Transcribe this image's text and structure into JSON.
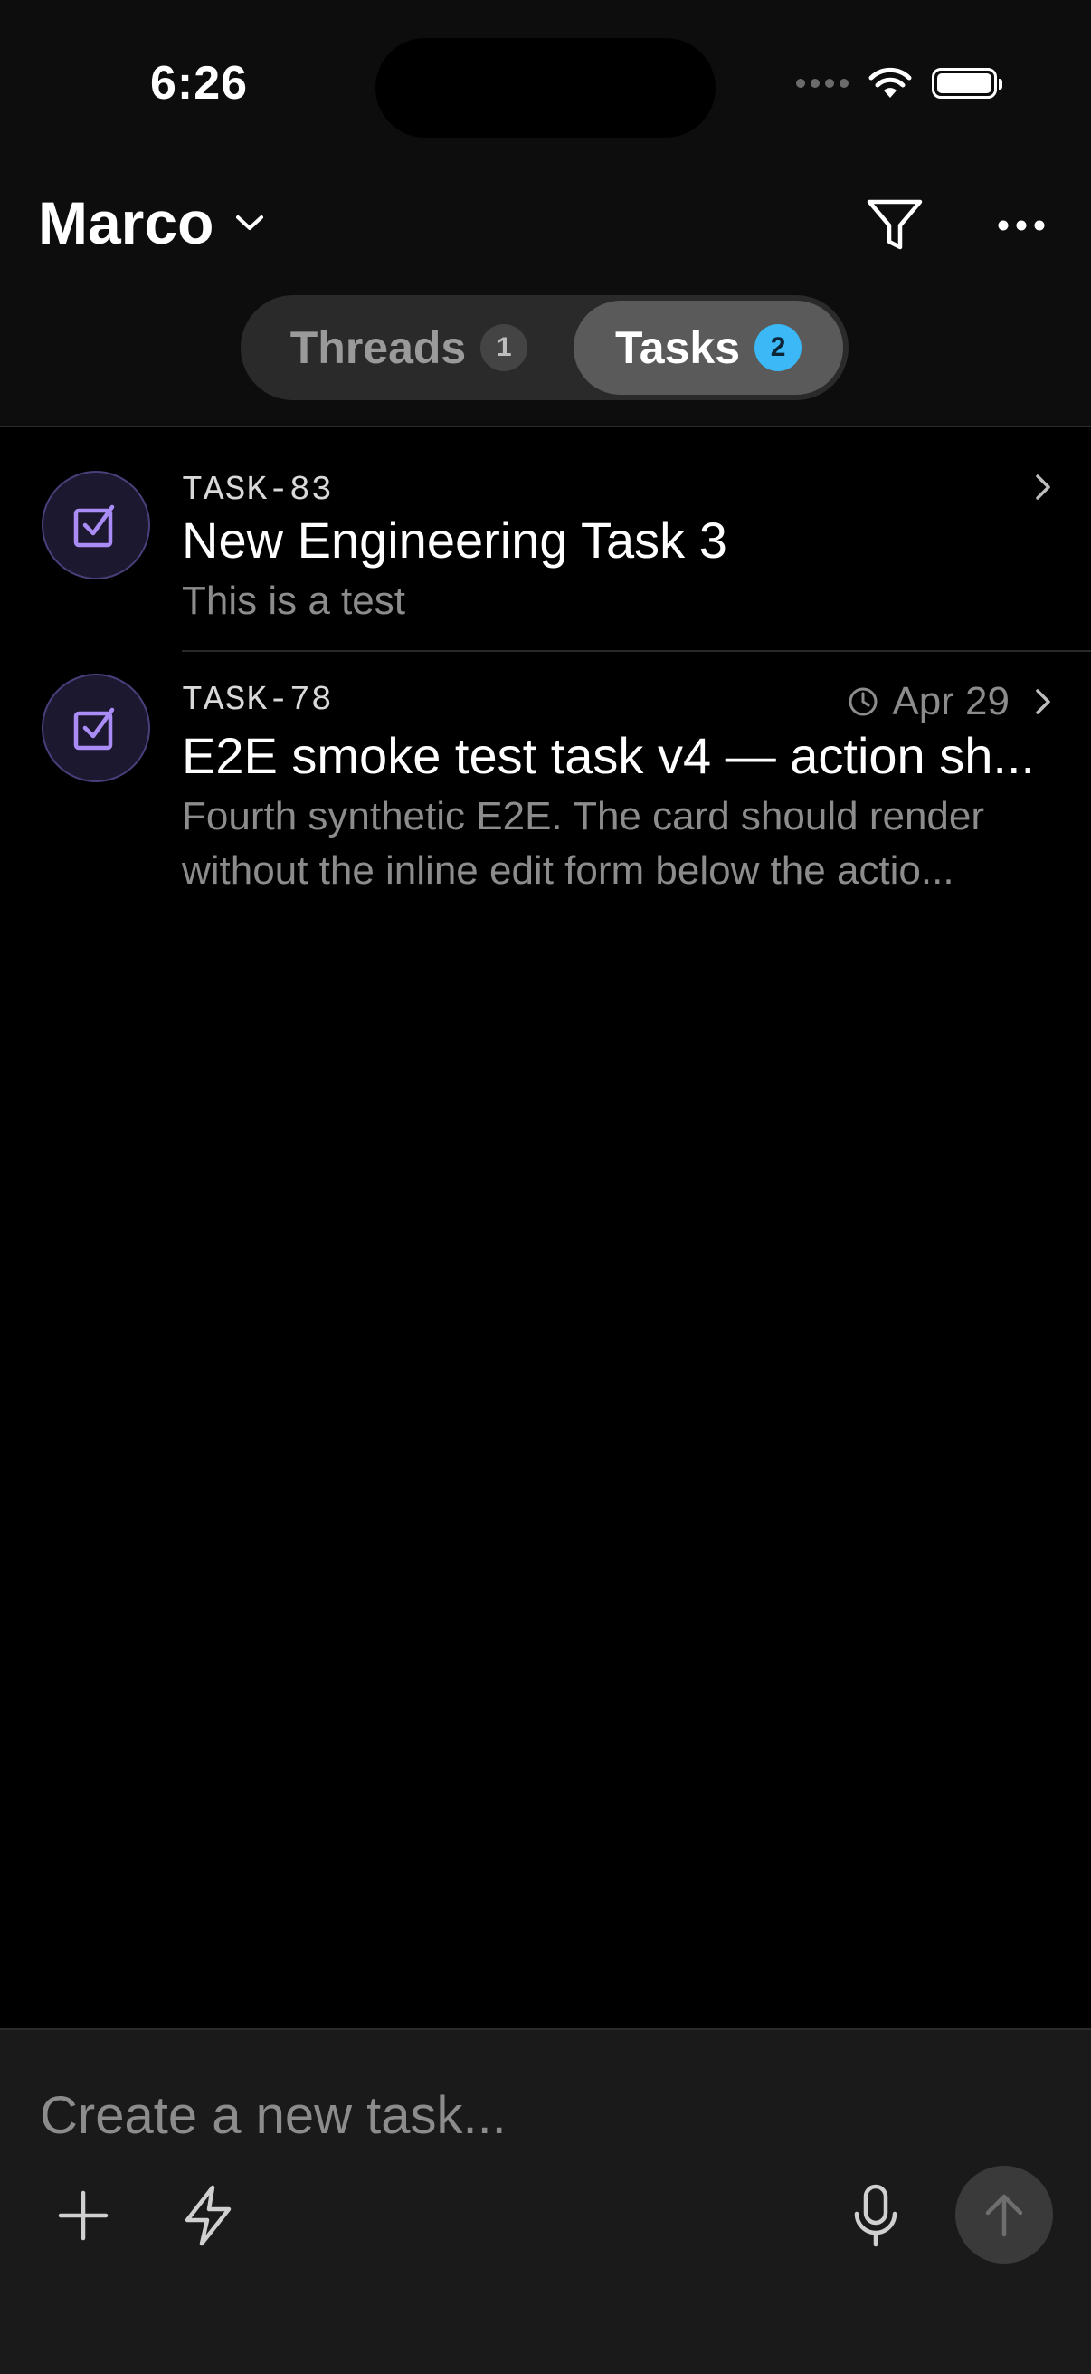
{
  "status_bar": {
    "time": "6:26"
  },
  "header": {
    "title": "Marco",
    "tabs": [
      {
        "label": "Threads",
        "count": "1",
        "selected": false
      },
      {
        "label": "Tasks",
        "count": "2",
        "selected": true
      }
    ]
  },
  "tasks": [
    {
      "id": "TASK-83",
      "title": "New Engineering Task 3",
      "description": "This is a test",
      "due": ""
    },
    {
      "id": "TASK-78",
      "title": "E2E smoke test task v4 — action sh...",
      "description": "Fourth synthetic E2E. The card should render without the inline edit form below the actio...",
      "due": "Apr 29"
    }
  ],
  "composer": {
    "placeholder": "Create a new task..."
  },
  "icons": {
    "title_dropdown": "chevron-down-icon",
    "filter": "filter-icon",
    "more": "more-horizontal-icon",
    "task": "checkbox-icon",
    "row_chevron": "chevron-right-icon",
    "due": "clock-icon",
    "add": "plus-icon",
    "quick": "lightning-icon",
    "mic": "microphone-icon",
    "send": "arrow-up-icon"
  },
  "colors": {
    "accent_purple": "#a98cf5",
    "badge_blue": "#3bb8f5"
  }
}
